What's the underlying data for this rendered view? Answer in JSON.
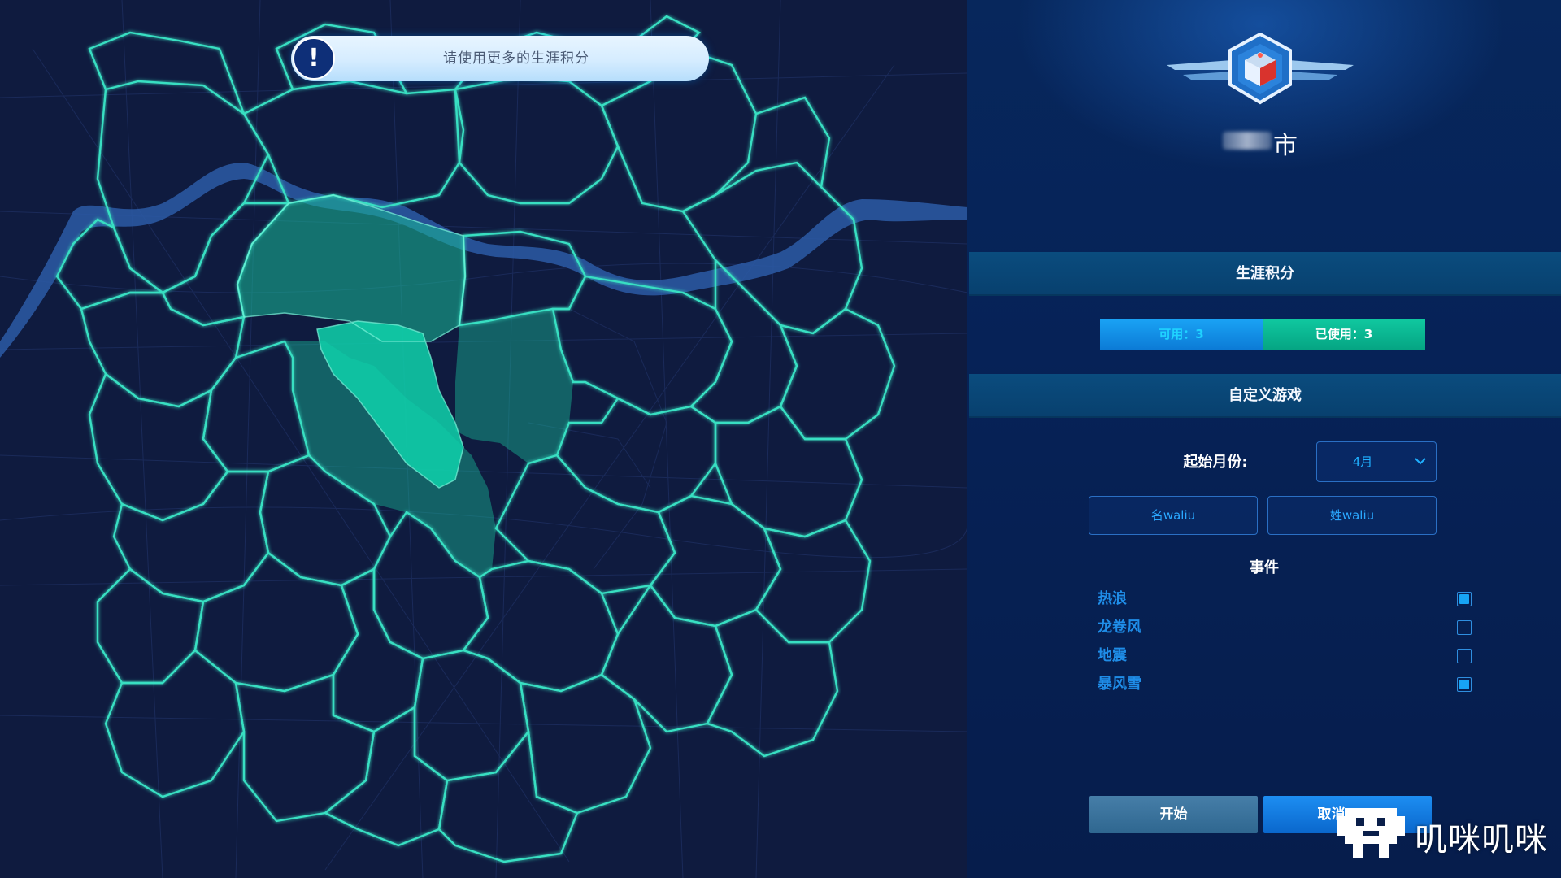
{
  "toast": {
    "icon": "exclamation-icon",
    "icon_glyph": "!",
    "message": "请使用更多的生涯积分"
  },
  "map": {
    "colors": {
      "background": "#0f1b3f",
      "border_glow": "#36e0c4",
      "river": "#2e5aa8",
      "selected_region": "#19c6a0",
      "active_region": "#0ed0aa"
    }
  },
  "panel": {
    "emblem": "winged-shield-logo",
    "city_suffix": "市",
    "career_title": "生涯积分",
    "credits": {
      "available": "可用：3",
      "used": "已使用：3"
    },
    "custom_title": "自定义游戏",
    "start_month_label": "起始月份:",
    "start_month_value": "4月",
    "first_name": "名waliu",
    "last_name": "姓waliu",
    "events_title": "事件",
    "events": [
      {
        "label": "热浪",
        "checked": true
      },
      {
        "label": "龙卷风",
        "checked": false
      },
      {
        "label": "地震",
        "checked": false
      },
      {
        "label": "暴风雪",
        "checked": true
      }
    ],
    "start_button": "开始",
    "cancel_button": "取消"
  },
  "watermark": {
    "text": "叽咪叽咪"
  }
}
